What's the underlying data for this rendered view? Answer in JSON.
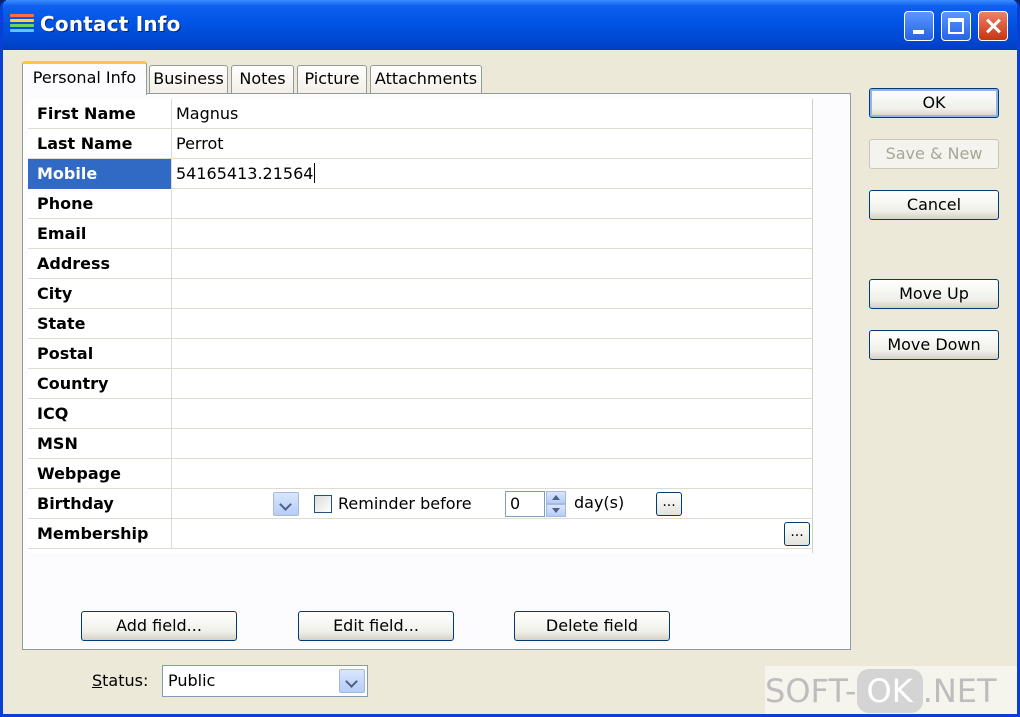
{
  "window": {
    "title": "Contact Info"
  },
  "tabs": [
    {
      "label": "Personal Info",
      "active": true
    },
    {
      "label": "Business",
      "active": false
    },
    {
      "label": "Notes",
      "active": false
    },
    {
      "label": "Picture",
      "active": false
    },
    {
      "label": "Attachments",
      "active": false
    }
  ],
  "fields": [
    {
      "label": "First Name",
      "value": "Magnus"
    },
    {
      "label": "Last Name",
      "value": "Perrot"
    },
    {
      "label": "Mobile",
      "value": "54165413.21564",
      "selected": true
    },
    {
      "label": "Phone",
      "value": ""
    },
    {
      "label": "Email",
      "value": ""
    },
    {
      "label": "Address",
      "value": ""
    },
    {
      "label": "City",
      "value": ""
    },
    {
      "label": "State",
      "value": ""
    },
    {
      "label": "Postal",
      "value": ""
    },
    {
      "label": "Country",
      "value": ""
    },
    {
      "label": "ICQ",
      "value": ""
    },
    {
      "label": "MSN",
      "value": ""
    },
    {
      "label": "Webpage",
      "value": ""
    },
    {
      "label": "Birthday",
      "value": ""
    },
    {
      "label": "Membership",
      "value": ""
    }
  ],
  "birthday": {
    "reminder_label": "Reminder before",
    "reminder_checked": false,
    "reminder_days": "0",
    "days_unit": "day(s)",
    "more_label": "..."
  },
  "membership": {
    "more_label": "..."
  },
  "grid_buttons": {
    "add": "Add field...",
    "edit": "Edit field...",
    "delete": "Delete field"
  },
  "side_buttons": {
    "ok": "OK",
    "save_new": "Save & New",
    "cancel": "Cancel",
    "move_up": "Move Up",
    "move_down": "Move Down"
  },
  "status": {
    "label_prefix": "S",
    "label_rest": "tatus:",
    "value": "Public"
  },
  "watermark": {
    "left": "SOFT-",
    "badge": "OK",
    "right": ".NET"
  },
  "colors": {
    "titlebar": "#0054e3",
    "selection": "#316ac5",
    "dialog_bg": "#ece9d8",
    "tab_highlight": "#ffc83c"
  }
}
